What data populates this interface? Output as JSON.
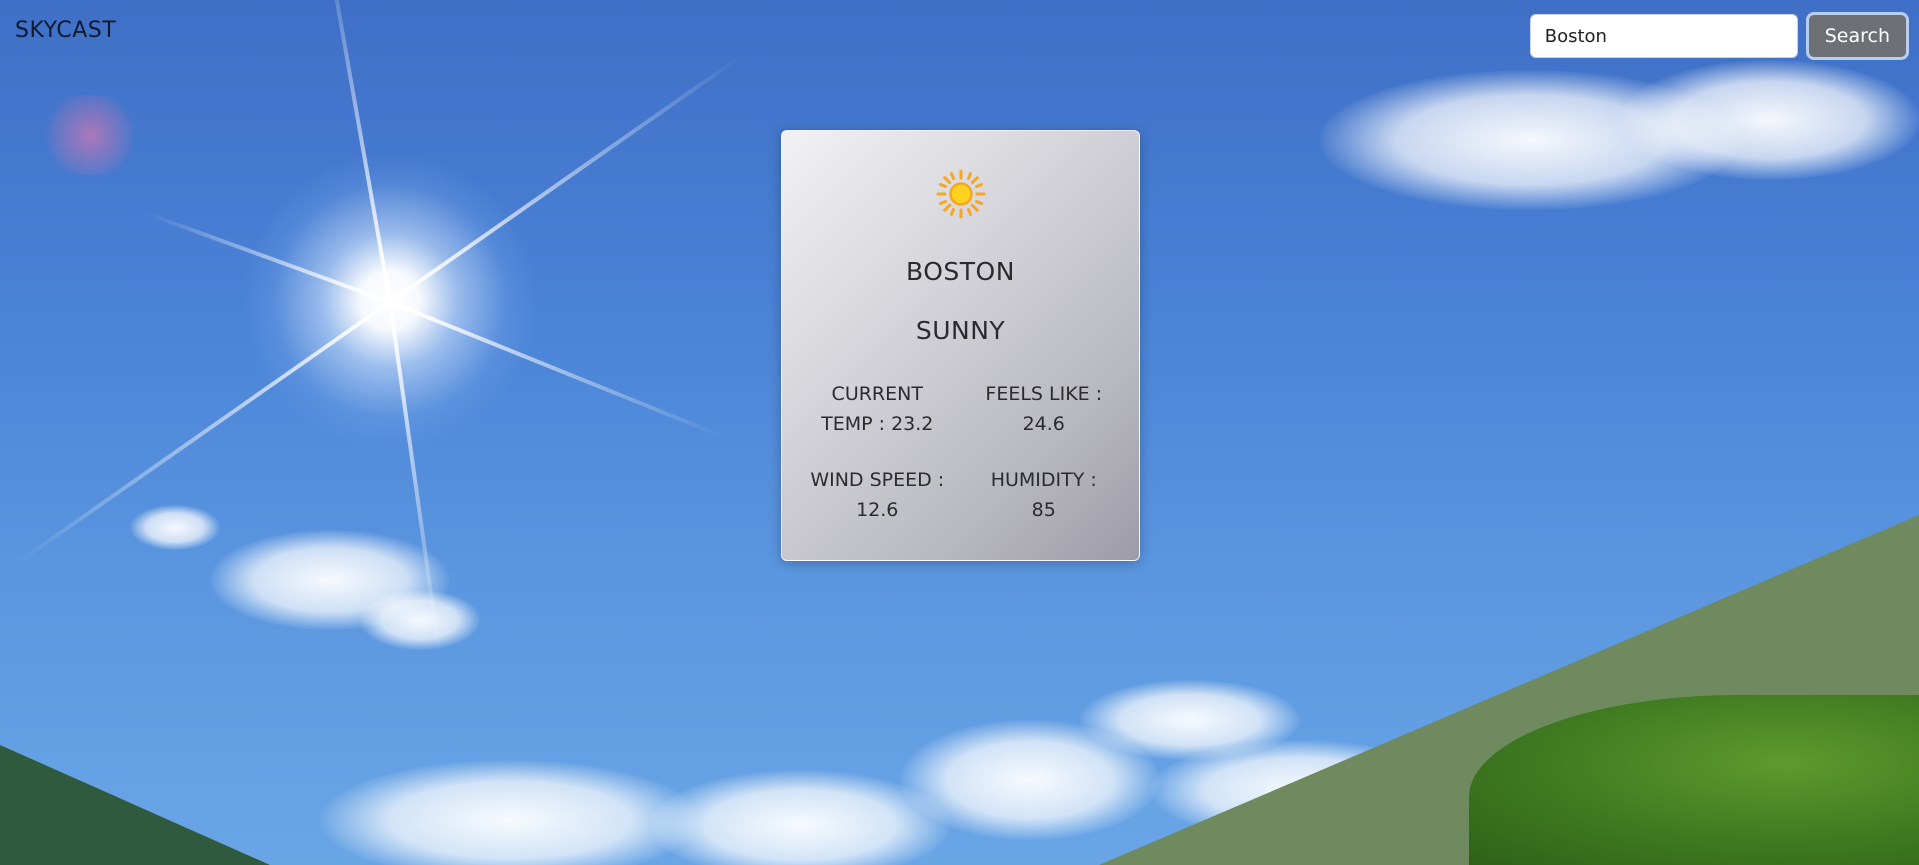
{
  "brand": {
    "name": "SKYCAST"
  },
  "search": {
    "value": "Boston",
    "button_label": "Search"
  },
  "weather": {
    "city": "BOSTON",
    "condition": "SUNNY",
    "icon": "sun-icon",
    "stats": {
      "current_temp_label_line1": "CURRENT",
      "current_temp_label_line2": "TEMP : 23.2",
      "feels_like_label": "FEELS LIKE :",
      "feels_like_value": "24.6",
      "wind_speed_label": "WIND SPEED :",
      "wind_speed_value": "12.6",
      "humidity_label": "HUMIDITY :",
      "humidity_value": "85"
    }
  },
  "colors": {
    "sky": "#4a82d6",
    "button_bg": "#6d7075",
    "card_light": "#f2f2f5",
    "card_dark": "#9d9ca6",
    "sun_icon": "#ffd21f"
  }
}
